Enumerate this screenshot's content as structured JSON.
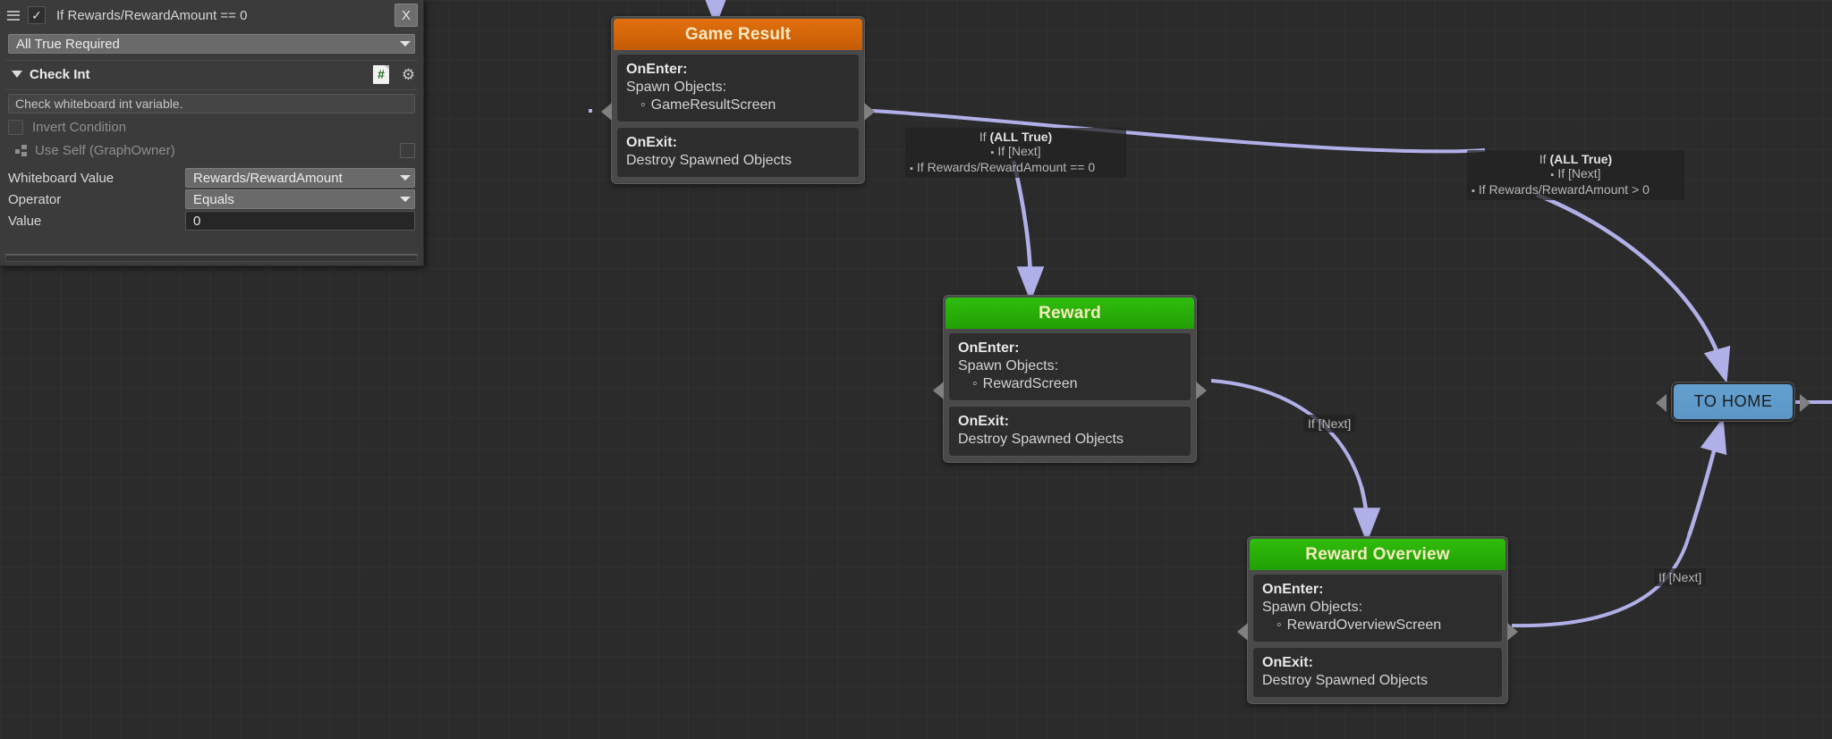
{
  "inspector": {
    "title": "If Rewards/RewardAmount == 0",
    "enabled_checkmark": "✓",
    "close_label": "X",
    "combine_mode": "All True Required",
    "section": {
      "title": "Check Int",
      "doc_icon_glyph": "#",
      "gear_icon_glyph": "⚙",
      "description": "Check whiteboard int variable.",
      "invert_condition_label": "Invert Condition",
      "use_self_label": "Use Self (GraphOwner)",
      "properties": [
        {
          "label": "Whiteboard Value",
          "value": "Rewards/RewardAmount",
          "type": "dropdown"
        },
        {
          "label": "Operator",
          "value": "Equals",
          "type": "dropdown"
        },
        {
          "label": "Value",
          "value": "0",
          "type": "text"
        }
      ]
    }
  },
  "graph": {
    "nodes": [
      {
        "id": "game-result",
        "title": "Game Result",
        "color": "#d3650a",
        "sections": [
          {
            "title": "OnEnter:",
            "line": "Spawn Objects:",
            "sub": "GameResultScreen"
          },
          {
            "title": "OnExit:",
            "line": "Destroy Spawned Objects",
            "sub": null
          }
        ]
      },
      {
        "id": "reward",
        "title": "Reward",
        "color": "#28ad08",
        "sections": [
          {
            "title": "OnEnter:",
            "line": "Spawn Objects:",
            "sub": "RewardScreen"
          },
          {
            "title": "OnExit:",
            "line": "Destroy Spawned Objects",
            "sub": null
          }
        ]
      },
      {
        "id": "reward-overview",
        "title": "Reward Overview",
        "color": "#28ad08",
        "sections": [
          {
            "title": "OnEnter:",
            "line": "Spawn Objects:",
            "sub": "RewardOverviewScreen"
          },
          {
            "title": "OnExit:",
            "line": "Destroy Spawned Objects",
            "sub": null
          }
        ]
      }
    ],
    "to_home": {
      "label": "TO HOME",
      "color": "#5b96c6"
    },
    "edge_labels": [
      {
        "id": "gr-to-reward",
        "line1_prefix": "If ",
        "line1_bold": "(ALL True)",
        "line2": "If [Next]",
        "line3": "If Rewards/RewardAmount == 0"
      },
      {
        "id": "gr-to-home",
        "line1_prefix": "If ",
        "line1_bold": "(ALL True)",
        "line2": "If [Next]",
        "line3": "If Rewards/RewardAmount > 0"
      },
      {
        "id": "reward-to-overview",
        "line1_prefix": "If [Next]"
      },
      {
        "id": "overview-to-home",
        "line1_prefix": "If [Next]"
      }
    ],
    "edge_color": "#b0b0e8"
  }
}
